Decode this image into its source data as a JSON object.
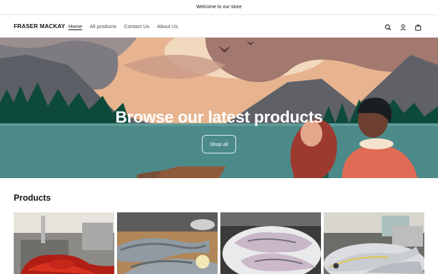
{
  "announcement": "Welcome to our store",
  "header": {
    "logo": "FRASER MACKAY",
    "nav": [
      {
        "label": "Home",
        "active": true
      },
      {
        "label": "All products",
        "active": false
      },
      {
        "label": "Contact Us",
        "active": false
      },
      {
        "label": "About Us",
        "active": false
      }
    ],
    "icons": [
      "search-icon",
      "account-icon",
      "cart-icon"
    ]
  },
  "hero": {
    "title": "Browse our latest products",
    "button_label": "Shop all"
  },
  "products": {
    "heading": "Products",
    "cards": [
      {
        "image": "lobsters-in-kitchen-sink"
      },
      {
        "image": "trout-fish-on-cutting-board"
      },
      {
        "image": "fish-fillets-on-plate"
      },
      {
        "image": "pompano-fish-on-plate"
      }
    ]
  },
  "colors": {
    "accent": "#121212",
    "hero_sky": "#e7b48f",
    "hero_lake": "#4c8a8a",
    "hero_forest": "#0e4a3a"
  }
}
